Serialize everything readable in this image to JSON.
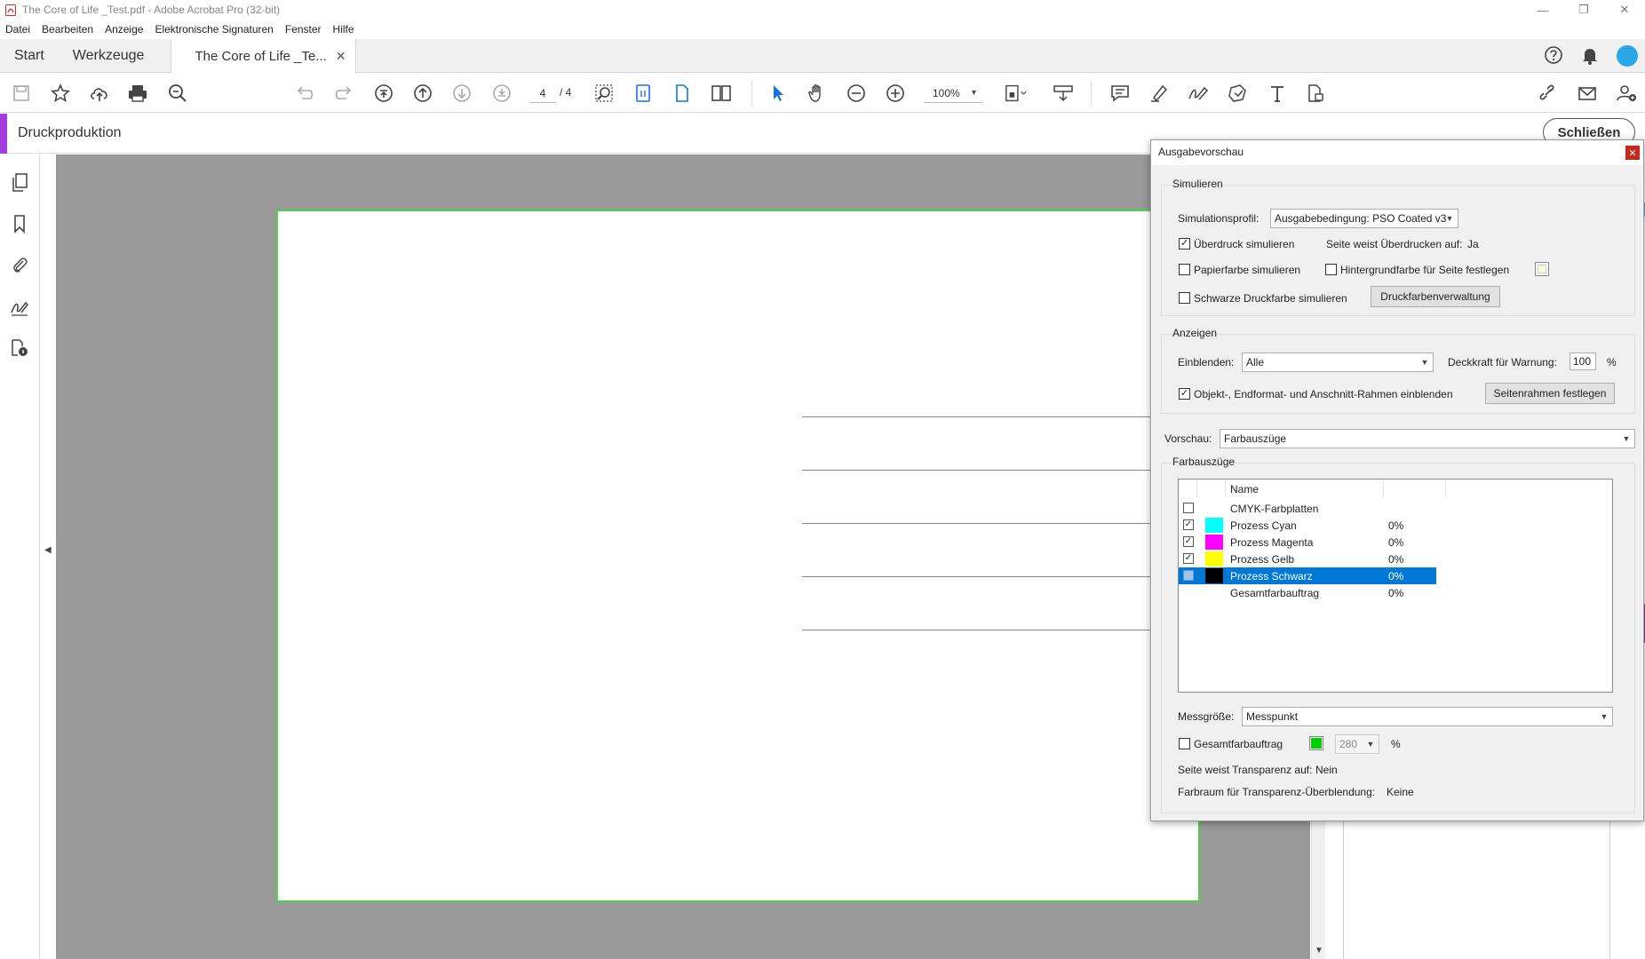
{
  "titlebar": {
    "title": "The Core of Life _Test.pdf - Adobe Acrobat Pro (32-bit)",
    "minimize": "—",
    "restore": "❐",
    "close": "✕"
  },
  "menubar": {
    "items": [
      "Datei",
      "Bearbeiten",
      "Anzeige",
      "Elektronische Signaturen",
      "Fenster",
      "Hilfe"
    ]
  },
  "tabs": {
    "start": "Start",
    "tools": "Werkzeuge",
    "document": "The Core of Life _Te...",
    "document_close": "✕"
  },
  "toolbar": {
    "page_current": "4",
    "page_total": "/ 4",
    "zoom": "100%"
  },
  "toolpane": {
    "title": "Druckproduktion",
    "close_button": "Schließen",
    "accent_color": "#a43bdc"
  },
  "dialog": {
    "title": "Ausgabevorschau",
    "simulate": {
      "group_label": "Simulieren",
      "profile_label": "Simulationsprofil:",
      "profile_value": "Ausgabebedingung: PSO Coated v3",
      "overprint_label": "Überdruck simulieren",
      "overprint_checked": true,
      "page_overprint_label": "Seite weist Überdrucken auf:",
      "page_overprint_value": "Ja",
      "paper_color_label": "Papierfarbe simulieren",
      "paper_color_checked": false,
      "bg_color_label": "Hintergrundfarbe für Seite festlegen",
      "bg_color_checked": false,
      "black_ink_label": "Schwarze Druckfarbe simulieren",
      "black_ink_checked": false,
      "ink_manager_button": "Druckfarbenverwaltung"
    },
    "display": {
      "group_label": "Anzeigen",
      "show_label": "Einblenden:",
      "show_value": "Alle",
      "opacity_label": "Deckkraft für Warnung:",
      "opacity_value": "100",
      "opacity_unit": "%",
      "boxes_label": "Objekt-, Endformat- und Anschnitt-Rahmen einblenden",
      "boxes_checked": true,
      "page_boxes_button": "Seitenrahmen festlegen"
    },
    "preview": {
      "label": "Vorschau:",
      "value": "Farbauszüge"
    },
    "separations": {
      "group_label": "Farbauszüge",
      "column_name": "Name",
      "rows": [
        {
          "name": "CMYK-Farbplatten",
          "value": "",
          "checked": false,
          "swatch": "",
          "selected": false
        },
        {
          "name": "Prozess Cyan",
          "value": "0%",
          "checked": true,
          "swatch": "#00ffff",
          "selected": false
        },
        {
          "name": "Prozess Magenta",
          "value": "0%",
          "checked": true,
          "swatch": "#ff00ff",
          "selected": false
        },
        {
          "name": "Prozess Gelb",
          "value": "0%",
          "checked": true,
          "swatch": "#ffff00",
          "selected": false
        },
        {
          "name": "Prozess Schwarz",
          "value": "0%",
          "checked": false,
          "swatch": "#000000",
          "selected": true
        },
        {
          "name": "Gesamtfarbauftrag",
          "value": "0%",
          "checked": false,
          "swatch": "",
          "selected": false
        }
      ],
      "sample_label": "Messgröße:",
      "sample_value": "Messpunkt",
      "total_coverage_label": "Gesamtfarbauftrag",
      "total_coverage_checked": false,
      "total_coverage_color": "#00d000",
      "total_coverage_value": "280",
      "total_coverage_unit": "%",
      "transparency_label": "Seite weist Transparenz auf:",
      "transparency_value": "Nein",
      "blend_space_label": "Farbraum für Transparenz-Überblendung:",
      "blend_space_value": "Keine"
    }
  }
}
